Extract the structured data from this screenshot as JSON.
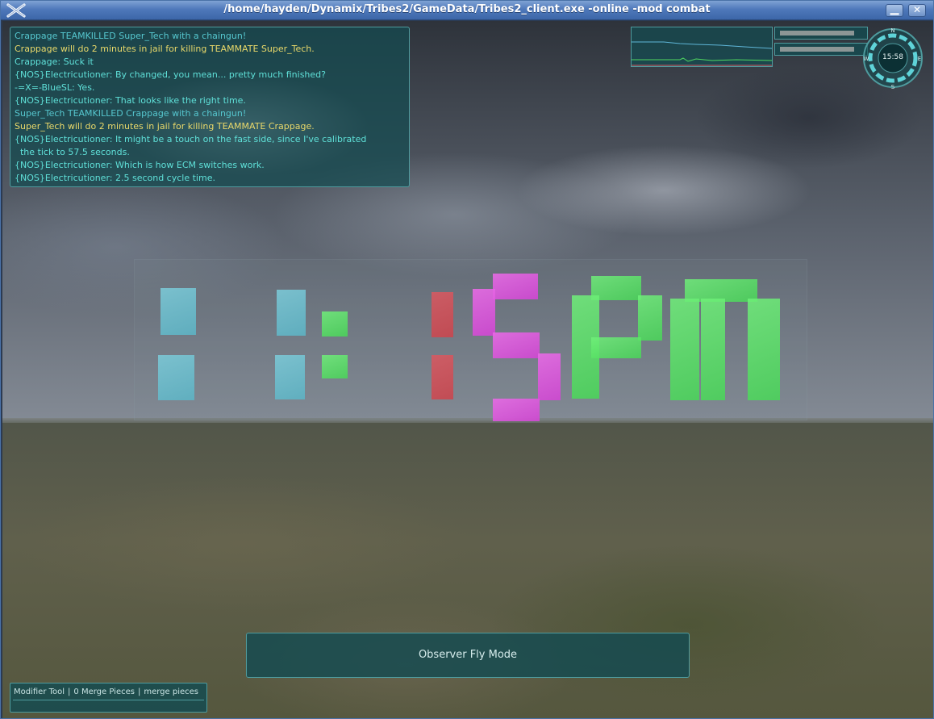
{
  "window": {
    "title": "/home/hayden/Dynamix/Tribes2/GameData/Tribes2_client.exe -online -mod combat",
    "minimize_glyph": "▁",
    "close_glyph": "✕"
  },
  "chat": {
    "lines": [
      {
        "text": "Crappage TEAMKILLED Super_Tech with a chaingun!",
        "color": "#56c7cf"
      },
      {
        "text": "Crappage will do 2 minutes in jail for killing TEAMMATE Super_Tech.",
        "color": "#e9d86a"
      },
      {
        "text": "Crappage: Suck it",
        "color": "#5fe0d8"
      },
      {
        "text": "{NOS}Electricutioner: By changed, you mean... pretty much finished?",
        "color": "#5fe0d8"
      },
      {
        "text": "-=X=-BlueSL: Yes.",
        "color": "#5fe0d8"
      },
      {
        "text": "{NOS}Electricutioner: That looks like the right time.",
        "color": "#5fe0d8"
      },
      {
        "text": "Super_Tech TEAMKILLED Crappage with a chaingun!",
        "color": "#56c7cf"
      },
      {
        "text": "Super_Tech will do 2 minutes in jail for killing TEAMMATE Crappage.",
        "color": "#e9d86a"
      },
      {
        "text": "{NOS}Electricutioner: It might be a touch on the fast side, since I've calibrated",
        "color": "#5fe0d8"
      },
      {
        "text": "  the tick to 57.5 seconds.",
        "color": "#5fe0d8"
      },
      {
        "text": "{NOS}Electricutioner: Which is how ECM switches work.",
        "color": "#5fe0d8"
      },
      {
        "text": "{NOS}Electricutioner: 2.5 second cycle time.",
        "color": "#5fe0d8"
      }
    ]
  },
  "hud": {
    "clock": "15:58",
    "compass_letters": [
      "N",
      "E",
      "S",
      "W"
    ],
    "observer_mode": "Observer Fly Mode"
  },
  "modifier_bar": {
    "tool": "Modifier Tool",
    "merge_count": "0 Merge Pieces",
    "action": "merge pieces"
  },
  "colors": {
    "hud_panel": "#144b50",
    "hud_border": "#4e9b9e",
    "clock_digit_cyan": "#7cc8d6",
    "clock_digit_red": "#d65a62",
    "clock_digit_magenta": "#e86be6",
    "clock_digit_green": "#70f07a"
  }
}
